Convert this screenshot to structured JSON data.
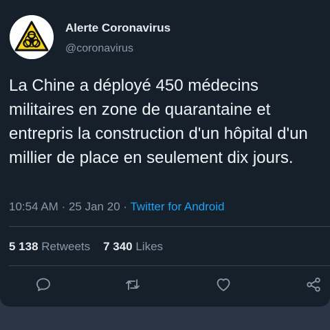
{
  "account": {
    "display_name": "Alerte Coronavirus",
    "handle": "@coronavirus",
    "avatar_icon": "biohazard-icon"
  },
  "tweet": {
    "text": "La Chine a déployé 450 médecins militaires en zone de quarantaine et entrepris la construction d'un hôpital d'un millier de place en seulement dix jours."
  },
  "meta": {
    "time": "10:54 AM",
    "separator": "·",
    "date": "25 Jan 20",
    "source": "Twitter for Android"
  },
  "stats": {
    "retweets_count": "5 138",
    "retweets_label": "Retweets",
    "likes_count": "7 340",
    "likes_label": "Likes"
  },
  "actions": {
    "reply_icon": "reply-icon",
    "retweet_icon": "retweet-icon",
    "like_icon": "heart-icon",
    "share_icon": "share-icon"
  },
  "colors": {
    "background": "#15202b",
    "text_primary": "#e6eaee",
    "text_secondary": "#8899a6",
    "accent": "#1da1f2",
    "biohazard_yellow": "#f3d21a"
  }
}
